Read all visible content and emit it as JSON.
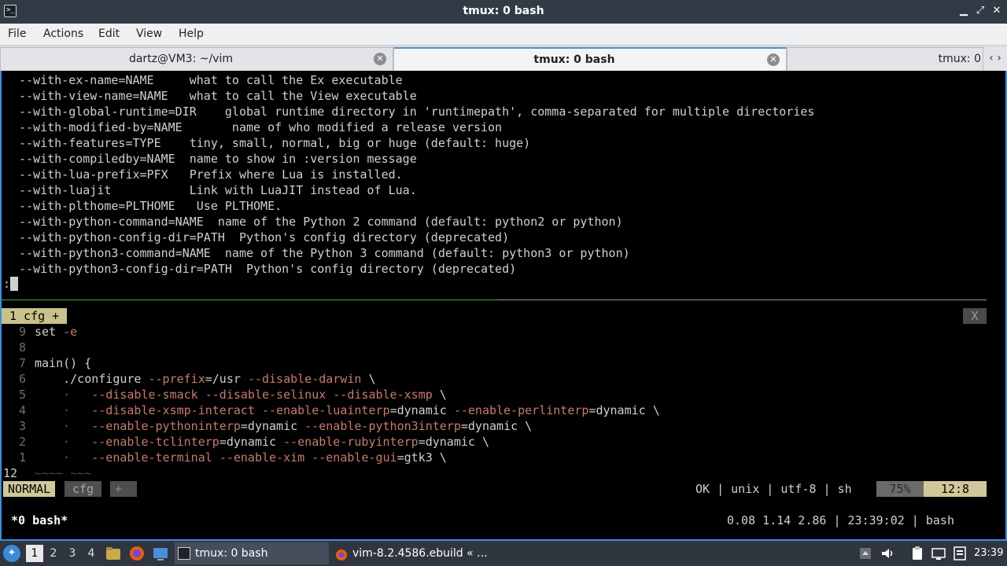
{
  "window": {
    "title": "tmux: 0 bash",
    "minimize": "▁",
    "maximize": "⤢",
    "close": "✕"
  },
  "menu": [
    "File",
    "Actions",
    "Edit",
    "View",
    "Help"
  ],
  "tabs": [
    {
      "label": "dartz@VM3: ~/vim",
      "active": false
    },
    {
      "label": "tmux: 0 bash",
      "active": true
    },
    {
      "label": "tmux: 0",
      "active": false
    }
  ],
  "tab_arrows": "‹ ›",
  "terminal": {
    "help_lines": [
      "--with-ex-name=NAME     what to call the Ex executable",
      "--with-view-name=NAME   what to call the View executable",
      "--with-global-runtime=DIR    global runtime directory in 'runtimepath', comma-separated for multiple directories",
      "--with-modified-by=NAME       name of who modified a release version",
      "--with-features=TYPE    tiny, small, normal, big or huge (default: huge)",
      "--with-compiledby=NAME  name to show in :version message",
      "--with-lua-prefix=PFX   Prefix where Lua is installed.",
      "--with-luajit           Link with LuaJIT instead of Lua.",
      "--with-plthome=PLTHOME   Use PLTHOME.",
      "--with-python-command=NAME  name of the Python 2 command (default: python2 or python)",
      "--with-python-config-dir=PATH  Python's config directory (deprecated)",
      "--with-python3-command=NAME  name of the Python 3 command (default: python3 or python)",
      "--with-python3-config-dir=PATH  Python's config directory (deprecated)"
    ],
    "prompt": ":"
  },
  "vim": {
    "tabline_label": "1 cfg +",
    "tabline_close": "X",
    "line_numbers": [
      "9",
      "8",
      "7",
      "6",
      "5",
      "4",
      "3",
      "2",
      "1",
      "12"
    ],
    "code": {
      "l9": "set ",
      "l9_flag": "-e",
      "l7": "main() {",
      "l6_cmd": "    ./configure ",
      "l6_opt1": "--prefix",
      "l6_val1": "=/usr ",
      "l6_opt2": "--disable-darwin",
      "l6_tail": " \\",
      "indent_dot": "    ·   ",
      "l5_opt1": "--disable-smack",
      "l5_opt2": "--disable-selinux",
      "l5_opt3": "--disable-xsmp",
      "l4_opt1": "--disable-xsmp-interact",
      "l4_opt2": "--enable-luainterp",
      "l4_val2": "=dynamic ",
      "l4_opt3": "--enable-perlinterp",
      "l4_val3": "=dynamic \\",
      "l3_opt1": "--enable-pythoninterp",
      "l3_val1": "=dynamic ",
      "l3_opt2": "--enable-python3interp",
      "l3_val2": "=dynamic \\",
      "l2_opt1": "--enable-tclinterp",
      "l2_val1": "=dynamic ",
      "l2_opt2": "--enable-rubyinterp",
      "l2_val2": "=dynamic \\",
      "l1_opt1": "--enable-terminal",
      "l1_opt2": "--enable-xim",
      "l1_opt3": "--enable-gui",
      "l1_val3": "=gtk3 \\",
      "tilde": "~~~~ ~~~"
    },
    "statusline": {
      "mode": "NORMAL",
      "file": "cfg",
      "modified": "+",
      "info": "OK | unix | utf-8 | sh",
      "percent": "75%",
      "position": "12:8"
    }
  },
  "tmux": {
    "window": "*0 bash*",
    "right": "0.08 1.14 2.86 | 23:39:02 | bash"
  },
  "taskbar": {
    "workspaces": [
      "1",
      "2",
      "3",
      "4"
    ],
    "active_workspace": "1",
    "tasks": [
      {
        "label": "tmux: 0 bash",
        "active": true
      },
      {
        "label": "vim-8.2.4586.ebuild « ...",
        "active": false
      }
    ],
    "clock": "23:39"
  }
}
